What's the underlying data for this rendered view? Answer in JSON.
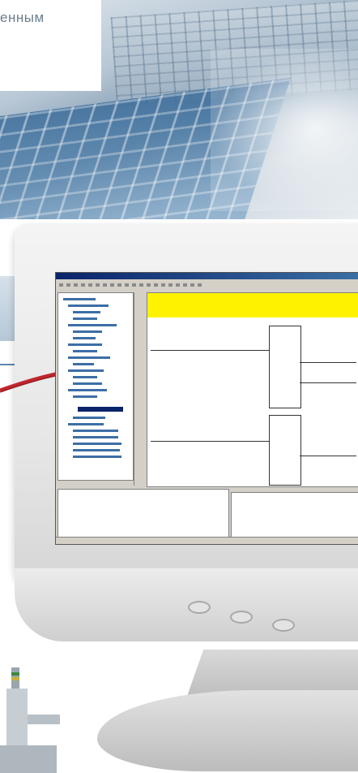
{
  "banner": {
    "text_fragment": "енным"
  },
  "colors": {
    "accent_blue": "#0a246a",
    "highlight_yellow": "#fff200",
    "cable_red": "#c0262d",
    "monitor_gray": "#e6e6e6"
  }
}
